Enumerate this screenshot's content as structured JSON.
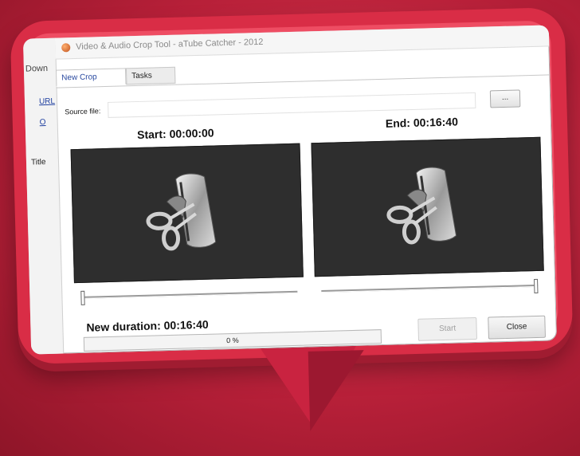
{
  "window": {
    "title": "Video & Audio Crop Tool - aTube Catcher - 2012"
  },
  "background_app": {
    "tab_label": "Down",
    "link1": "URL",
    "link2": "O",
    "column_title": "Title"
  },
  "tabs": [
    {
      "label": "New Crop",
      "active": true
    },
    {
      "label": "Tasks",
      "active": false
    }
  ],
  "source": {
    "label": "Source file:",
    "value": "",
    "browse_label": "..."
  },
  "start": {
    "label": "Start: 00:00:00"
  },
  "end": {
    "label": "End: 00:16:40"
  },
  "sliders": {
    "start_position": 0.0,
    "end_position": 1.0
  },
  "duration": {
    "label": "New duration: 00:16:40"
  },
  "progress": {
    "value": 0,
    "text": "0 %"
  },
  "buttons": {
    "start": {
      "label": "Start",
      "enabled": false
    },
    "close": {
      "label": "Close",
      "enabled": true
    }
  },
  "icons": [
    "app-icon",
    "scissors-film-icon"
  ],
  "colors": {
    "frame_red": "#d92d46",
    "background_red": "#b82039",
    "preview_bg": "#2e2e2e",
    "tab_active_text": "#2a4aa0"
  }
}
